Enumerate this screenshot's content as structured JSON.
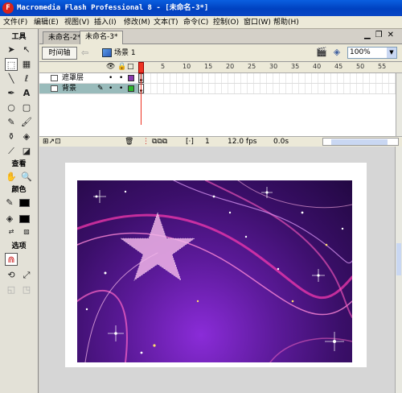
{
  "window": {
    "title": "Macromedia Flash Professional 8 - [未命名-3*]",
    "app_icon_letter": "F"
  },
  "menu": [
    "文件(F)",
    "编辑(E)",
    "视图(V)",
    "插入(I)",
    "修改(M)",
    "文本(T)",
    "命令(C)",
    "控制(O)",
    "窗口(W)",
    "帮助(H)"
  ],
  "toolbox": {
    "title": "工具",
    "view_header": "查看",
    "colors_header": "颜色",
    "options_header": "选项",
    "stroke_color": "#000000",
    "fill_color": "#000000"
  },
  "tabs": [
    "未命名-2*",
    "未命名-3*"
  ],
  "edit_bar": {
    "timeline_label": "时间轴",
    "scene_label": "场景 1",
    "zoom": "100%"
  },
  "timeline": {
    "frame_numbers": [
      "1",
      "5",
      "10",
      "15",
      "20",
      "25",
      "30",
      "35",
      "40",
      "45",
      "50",
      "55"
    ],
    "layers": [
      {
        "name": "遮罩层",
        "color": "#8a3ab0",
        "active": false
      },
      {
        "name": "背景",
        "color": "#2db82d",
        "active": true
      }
    ],
    "current_frame": "1",
    "fps": "12.0 fps",
    "time": "0.0s"
  },
  "colors": {
    "title_bar": "#0041c0",
    "artwork_purple": "#5c1a9a",
    "star_pink": "#f0b4e8"
  }
}
